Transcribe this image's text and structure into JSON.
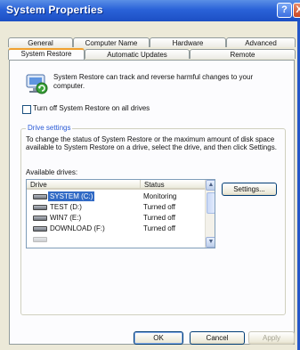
{
  "window": {
    "title": "System Properties",
    "help_label": "?",
    "close_label": "X"
  },
  "tabs": {
    "row1": [
      "General",
      "Computer Name",
      "Hardware",
      "Advanced"
    ],
    "row2": [
      "System Restore",
      "Automatic Updates",
      "Remote"
    ],
    "active": "System Restore"
  },
  "system_restore": {
    "intro": "System Restore can track and reverse harmful changes to your computer.",
    "turn_off_label": "Turn off System Restore on all drives",
    "turn_off_checked": false,
    "drive_settings_title": "Drive settings",
    "drive_settings_desc": "To change the status of System Restore or the maximum amount of disk space available to System Restore on a drive, select the drive, and then click Settings.",
    "available_drives_label": "Available drives:",
    "columns": [
      "Drive",
      "Status"
    ],
    "drives": [
      {
        "name": "SYSTEM (C:)",
        "status": "Monitoring",
        "selected": true
      },
      {
        "name": "TEST (D:)",
        "status": "Turned off",
        "selected": false
      },
      {
        "name": "WIN7 (E:)",
        "status": "Turned off",
        "selected": false
      },
      {
        "name": "DOWNLOAD (F:)",
        "status": "Turned off",
        "selected": false
      }
    ],
    "settings_button": "Settings..."
  },
  "footer": {
    "ok": "OK",
    "cancel": "Cancel",
    "apply": "Apply"
  }
}
